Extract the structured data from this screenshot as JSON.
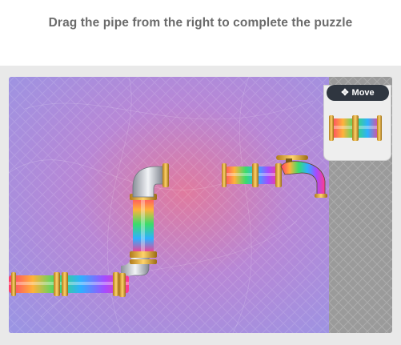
{
  "instruction": "Drag the pipe from the right to complete the puzzle",
  "move_button": {
    "label": "Move",
    "icon": "move-arrows-icon"
  },
  "colors": {
    "frame": "#e9e9e9",
    "title": "#6b6b6b",
    "tray": "#9a9a9a",
    "button": "#2f3640"
  }
}
